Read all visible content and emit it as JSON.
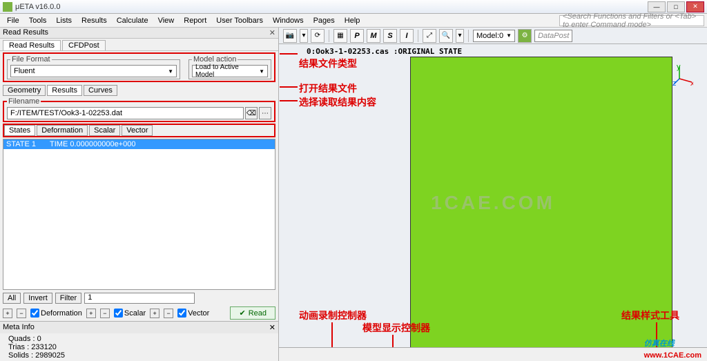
{
  "window": {
    "title": "μETA v16.0.0"
  },
  "menu": [
    "File",
    "Tools",
    "Lists",
    "Results",
    "Calculate",
    "View",
    "Report",
    "User Toolbars",
    "Windows",
    "Pages",
    "Help"
  ],
  "search_placeholder": "<Search Functions and Filters or <Tab> to enter Command mode>",
  "winbtns": {
    "min": "—",
    "max": "□",
    "close": "✕"
  },
  "leftpanel": {
    "title": "Read Results",
    "tabs": [
      "Read Results",
      "CFDPost"
    ],
    "file_format": {
      "legend": "File Format",
      "value": "Fluent"
    },
    "model_action": {
      "legend": "Model action",
      "value": "Load to Active Model"
    },
    "viewtabs": [
      "Geometry",
      "Results",
      "Curves"
    ],
    "filename": {
      "legend": "Filename",
      "value": "F:/ITEM/TEST/Ook3-1-02253.dat"
    },
    "subtabs": [
      "States",
      "Deformation",
      "Scalar",
      "Vector"
    ],
    "listrow": {
      "state": "STATE 1",
      "time": "TIME 0.000000000e+000"
    },
    "bottom": {
      "all": "All",
      "invert": "Invert",
      "filter": "Filter",
      "value": "1"
    },
    "checks": {
      "deformation": "Deformation",
      "scalar": "Scalar",
      "vector": "Vector"
    },
    "read_btn": "Read",
    "meta": {
      "title": "Meta Info",
      "quads_label": "Quads :",
      "quads": "0",
      "trias_label": "Trias :",
      "trias": "233120",
      "solids_label": "Solids :",
      "solids": "2989025"
    }
  },
  "toolbar": {
    "model_label": "Model:0",
    "datapost": "DataPost",
    "icons": [
      "camera-icon",
      "chevron-down-icon",
      "sync-icon",
      "grid-icon",
      "p-icon",
      "m-icon",
      "s-icon",
      "i-icon",
      "zoom-fit-icon",
      "zoom-icon",
      "chevron-down-icon"
    ]
  },
  "viewport": {
    "title": "0:Ook3-1-02253.cas    :ORIGINAL STATE",
    "watermark": "1CAE.COM",
    "axes": {
      "x": "x",
      "y": "y",
      "z": "z"
    }
  },
  "annotations": {
    "a1": "结果文件类型",
    "a2": "打开结果文件",
    "a3": "选择读取结果内容",
    "a4": "动画录制控制器",
    "a5": "模型显示控制器",
    "a6": "结果样式工具"
  },
  "footer": {
    "cn": "仿真在线",
    "url": "www.1CAE.com"
  }
}
